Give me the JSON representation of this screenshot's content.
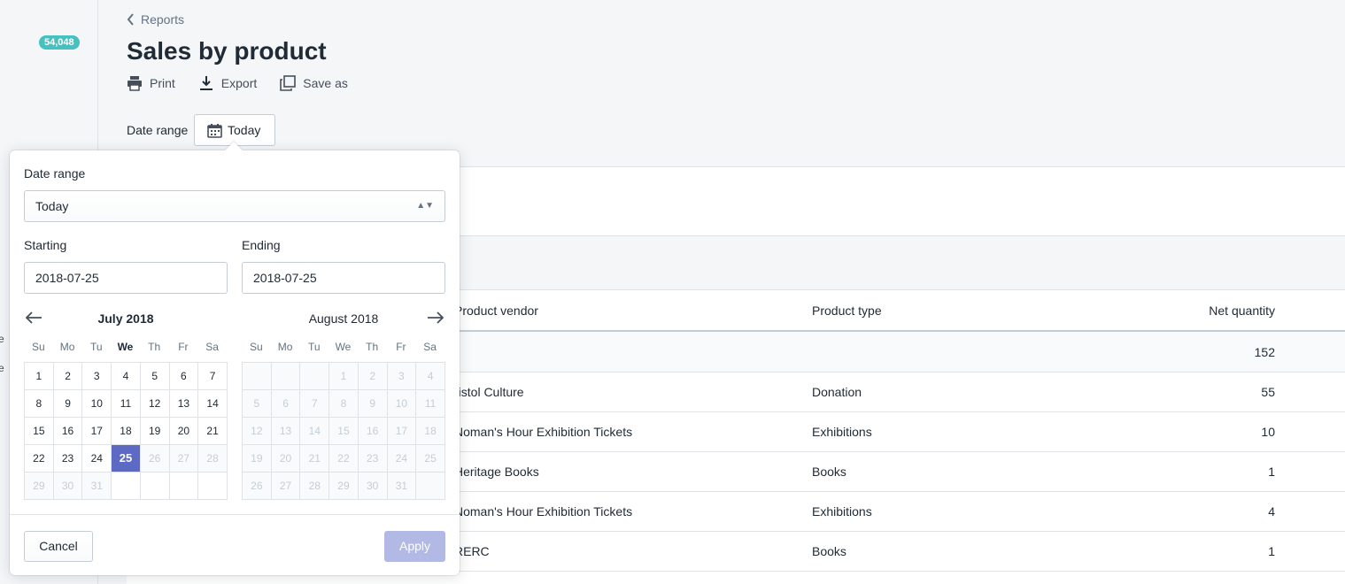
{
  "sidebar": {
    "badge": "54,048",
    "fragments": [
      "e",
      "e"
    ]
  },
  "header": {
    "back_label": "Reports",
    "title": "Sales by product",
    "actions": {
      "print": "Print",
      "export": "Export",
      "save_as": "Save as"
    },
    "date_range_label": "Date range",
    "date_range_button": "Today"
  },
  "table": {
    "columns": {
      "vendor": "Product vendor",
      "type": "Product type",
      "qty": "Net quantity"
    },
    "total_qty": "152",
    "rows": [
      {
        "vendor": "ristol Culture",
        "type": "Donation",
        "qty": "55"
      },
      {
        "vendor": "Noman's Hour Exhibition Tickets",
        "type": "Exhibitions",
        "qty": "10"
      },
      {
        "vendor": "Heritage Books",
        "type": "Books",
        "qty": "1"
      },
      {
        "vendor": "Noman's Hour Exhibition Tickets",
        "type": "Exhibitions",
        "qty": "4"
      },
      {
        "vendor": "RERC",
        "type": "Books",
        "qty": "1"
      }
    ]
  },
  "popover": {
    "range_label": "Date range",
    "range_value": "Today",
    "starting_label": "Starting",
    "starting_value": "2018-07-25",
    "ending_label": "Ending",
    "ending_value": "2018-07-25",
    "weekdays": [
      "Su",
      "Mo",
      "Tu",
      "We",
      "Th",
      "Fr",
      "Sa"
    ],
    "left_month": "July 2018",
    "right_month": "August 2018",
    "left_days": [
      "1",
      "2",
      "3",
      "4",
      "5",
      "6",
      "7",
      "8",
      "9",
      "10",
      "11",
      "12",
      "13",
      "14",
      "15",
      "16",
      "17",
      "18",
      "19",
      "20",
      "21",
      "22",
      "23",
      "24",
      "25",
      "26",
      "27",
      "28",
      "29",
      "30",
      "31",
      "",
      "",
      "",
      ""
    ],
    "left_selected": "25",
    "right_days": [
      "",
      "",
      "",
      "1",
      "2",
      "3",
      "4",
      "5",
      "6",
      "7",
      "8",
      "9",
      "10",
      "11",
      "12",
      "13",
      "14",
      "15",
      "16",
      "17",
      "18",
      "19",
      "20",
      "21",
      "22",
      "23",
      "24",
      "25",
      "26",
      "27",
      "28",
      "29",
      "30",
      "31",
      ""
    ],
    "cancel_label": "Cancel",
    "apply_label": "Apply"
  },
  "colors": {
    "accent": "#5c6ac4",
    "badge": "#47c1bf",
    "apply_disabled": "#b3b9e5"
  }
}
